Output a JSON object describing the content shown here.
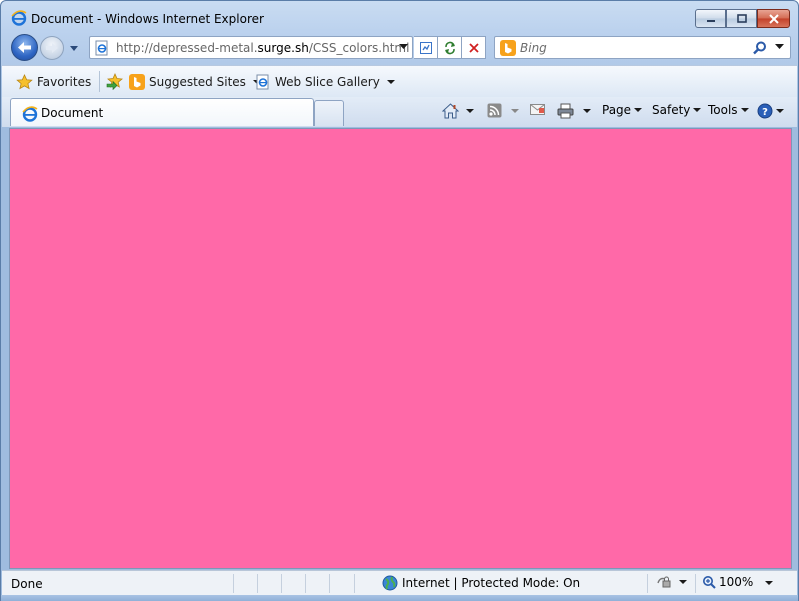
{
  "window": {
    "title": "Document - Windows Internet Explorer",
    "minimize_label": "Minimize",
    "maximize_label": "Restore",
    "close_label": "Close"
  },
  "address_bar": {
    "url_prefix": "http://depressed-metal.",
    "url_domain": "surge.sh",
    "url_suffix": "/CSS_colors.html"
  },
  "search": {
    "placeholder": "Bing"
  },
  "favorites_bar": {
    "favorites_label": "Favorites",
    "items": [
      {
        "label": "Suggested Sites"
      },
      {
        "label": "Web Slice Gallery"
      }
    ]
  },
  "tabs": [
    {
      "label": "Document",
      "icon": "ie-page-icon",
      "active": true
    }
  ],
  "command_bar": {
    "page_label": "Page",
    "safety_label": "Safety",
    "tools_label": "Tools"
  },
  "page": {
    "background_color": "#ff69a8"
  },
  "status_bar": {
    "status_text": "Done",
    "zone_text": "Internet | Protected Mode: On",
    "zoom_text": "100%"
  },
  "colors": {
    "chrome_blue": "#bcd2ee",
    "back_button": "#2f66c4",
    "bing_orange": "#f7a21b",
    "stop_red": "#d02020"
  }
}
